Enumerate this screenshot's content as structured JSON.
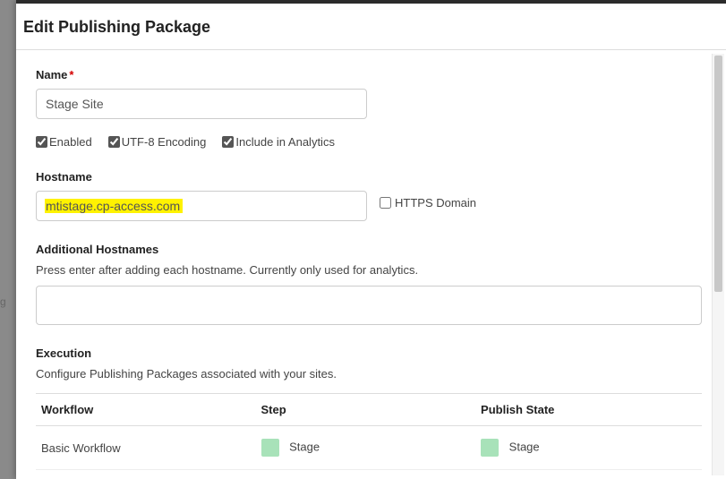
{
  "title": "Edit Publishing Package",
  "name": {
    "label": "Name",
    "value": "Stage Site",
    "required": true
  },
  "checks": {
    "enabled": {
      "label": "Enabled",
      "checked": true
    },
    "utf8": {
      "label": "UTF-8 Encoding",
      "checked": true
    },
    "analytics": {
      "label": "Include in Analytics",
      "checked": true
    }
  },
  "hostname": {
    "label": "Hostname",
    "value": "mtistage.cp-access.com",
    "https": {
      "label": "HTTPS Domain",
      "checked": false
    }
  },
  "additional": {
    "label": "Additional Hostnames",
    "helper": "Press enter after adding each hostname. Currently only used for analytics.",
    "value": ""
  },
  "execution": {
    "label": "Execution",
    "helper": "Configure Publishing Packages associated with your sites.",
    "headers": {
      "workflow": "Workflow",
      "step": "Step",
      "state": "Publish State"
    },
    "rows": [
      {
        "workflow": "Basic Workflow",
        "step": "Stage",
        "state": "Stage"
      }
    ]
  },
  "bg_fragment": "g"
}
